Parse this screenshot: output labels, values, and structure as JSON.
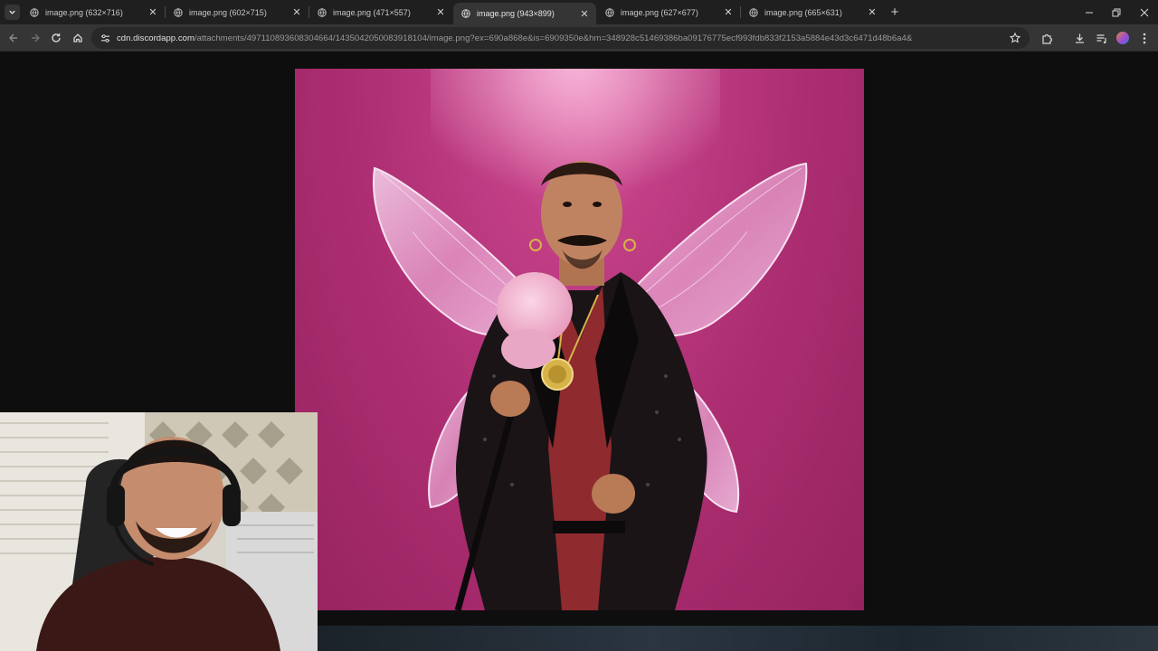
{
  "browser": {
    "tabs": [
      {
        "title": "image.png (632×716)",
        "active": false
      },
      {
        "title": "image.png (602×715)",
        "active": false
      },
      {
        "title": "image.png (471×557)",
        "active": false
      },
      {
        "title": "image.png (943×899)",
        "active": true
      },
      {
        "title": "image.png (627×677)",
        "active": false
      },
      {
        "title": "image.png (665×631)",
        "active": false
      }
    ],
    "url_host": "cdn.discordapp.com",
    "url_path": "/attachments/497110893608304664/1435042050083918104/image.png?ex=690a868e&is=6909350e&hm=348928c51469386ba09176775ecf993fdb833f2153a5884e43d3c6471d48b6a4&",
    "accent_color": "#c23f86"
  },
  "icons": {
    "tab_search": "chevron-down-icon",
    "favicon": "globe-icon",
    "close": "close-icon",
    "new_tab": "plus-icon",
    "back": "back-arrow-icon",
    "forward": "forward-arrow-icon",
    "reload": "reload-icon",
    "home": "home-icon",
    "site_info": "tune-icon",
    "bookmark": "star-icon",
    "extensions": "puzzle-icon",
    "downloads": "download-icon",
    "reading": "media-icon",
    "menu": "kebab-icon"
  }
}
